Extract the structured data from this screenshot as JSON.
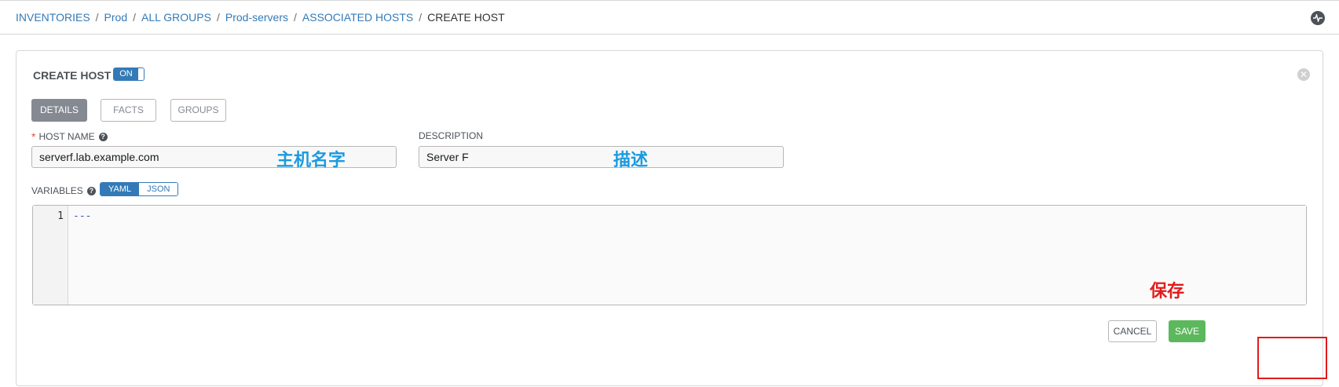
{
  "breadcrumb": {
    "items": [
      "INVENTORIES",
      "Prod",
      "ALL GROUPS",
      "Prod-servers",
      "ASSOCIATED HOSTS"
    ],
    "current": "CREATE HOST",
    "separator": "/"
  },
  "header": {
    "activity_icon": "activity-stream-icon"
  },
  "panel": {
    "title": "CREATE HOST",
    "toggle_label": "ON",
    "close_icon": "close-circle-icon"
  },
  "tabs": [
    {
      "label": "DETAILS",
      "active": true
    },
    {
      "label": "FACTS",
      "active": false
    },
    {
      "label": "GROUPS",
      "active": false
    }
  ],
  "form": {
    "host_name": {
      "label": "HOST NAME",
      "required_marker": "*",
      "value": "serverf.lab.example.com"
    },
    "description": {
      "label": "DESCRIPTION",
      "value": "Server F"
    },
    "variables": {
      "label": "VARIABLES",
      "formats": [
        "YAML",
        "JSON"
      ],
      "selected_format": "YAML",
      "line_numbers": [
        "1"
      ],
      "content": "---"
    }
  },
  "annotations": {
    "host_name": "主机名字",
    "description": "描述",
    "save": "保存"
  },
  "actions": {
    "cancel_label": "CANCEL",
    "save_label": "SAVE"
  },
  "colors": {
    "link": "#337ab7",
    "save": "#5cb85c",
    "annotation_blue": "#1a9be0",
    "annotation_red": "#e31b1b"
  }
}
